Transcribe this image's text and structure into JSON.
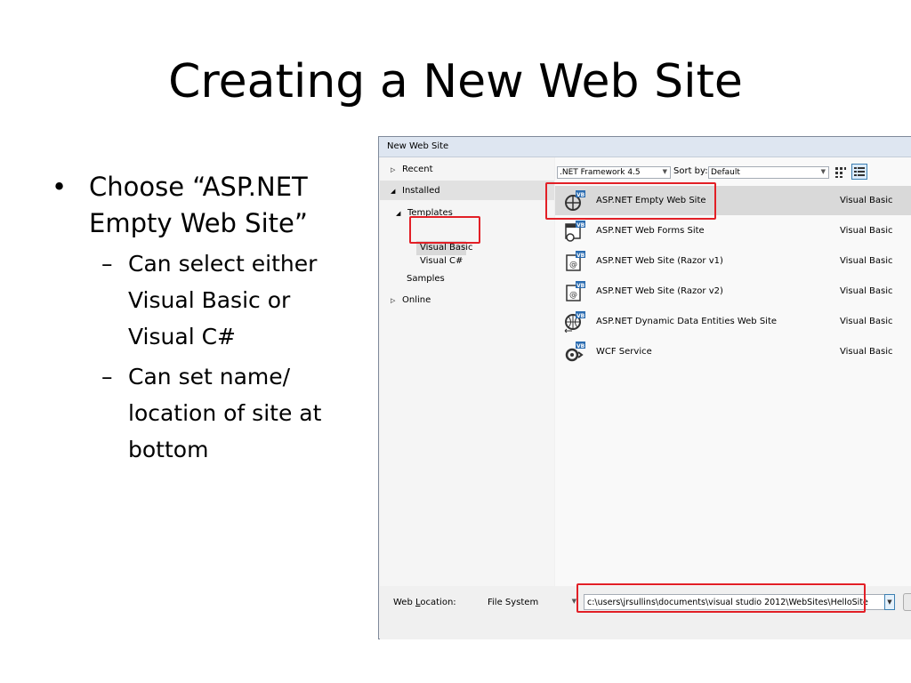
{
  "slide": {
    "title": "Creating a New Web Site",
    "bullets": [
      {
        "text": "Choose “ASP.NET Empty Web Site”",
        "subs": [
          "Can select either Visual Basic or Visual C#",
          "Can set name/ location of site at bottom"
        ]
      }
    ],
    "bullet_glyph": "•",
    "dash_glyph": "–"
  },
  "dialog": {
    "title": "New Web Site",
    "tree": {
      "recent": "Recent",
      "installed": "Installed",
      "templates": "Templates",
      "visual_basic": "Visual Basic",
      "visual_csharp": "Visual C#",
      "samples": "Samples",
      "online": "Online"
    },
    "toolbar": {
      "framework": ".NET Framework 4.5",
      "sort_label": "Sort by:",
      "sort_value": "Default"
    },
    "templates": [
      {
        "name": "ASP.NET Empty Web Site",
        "lang": "Visual Basic",
        "icon": "empty-web-site-icon",
        "selected": true
      },
      {
        "name": "ASP.NET Web Forms Site",
        "lang": "Visual Basic",
        "icon": "web-forms-icon"
      },
      {
        "name": "ASP.NET Web Site (Razor v1)",
        "lang": "Visual Basic",
        "icon": "razor-icon"
      },
      {
        "name": "ASP.NET Web Site (Razor v2)",
        "lang": "Visual Basic",
        "icon": "razor-icon"
      },
      {
        "name": "ASP.NET Dynamic Data Entities Web Site",
        "lang": "Visual Basic",
        "icon": "dynamic-data-icon"
      },
      {
        "name": "WCF Service",
        "lang": "Visual Basic",
        "icon": "wcf-service-icon"
      }
    ],
    "bottom": {
      "web_location_prefix": "Web ",
      "web_location_key": "L",
      "web_location_suffix": "ocation:",
      "location_type": "File System",
      "path": "c:\\users\\jrsullins\\documents\\visual studio 2012\\WebSites\\HelloSite"
    }
  },
  "colors": {
    "highlight_red": "#e21f26",
    "vb_badge_blue": "#2b6cb0",
    "selection_gray": "#d9d9d9"
  }
}
